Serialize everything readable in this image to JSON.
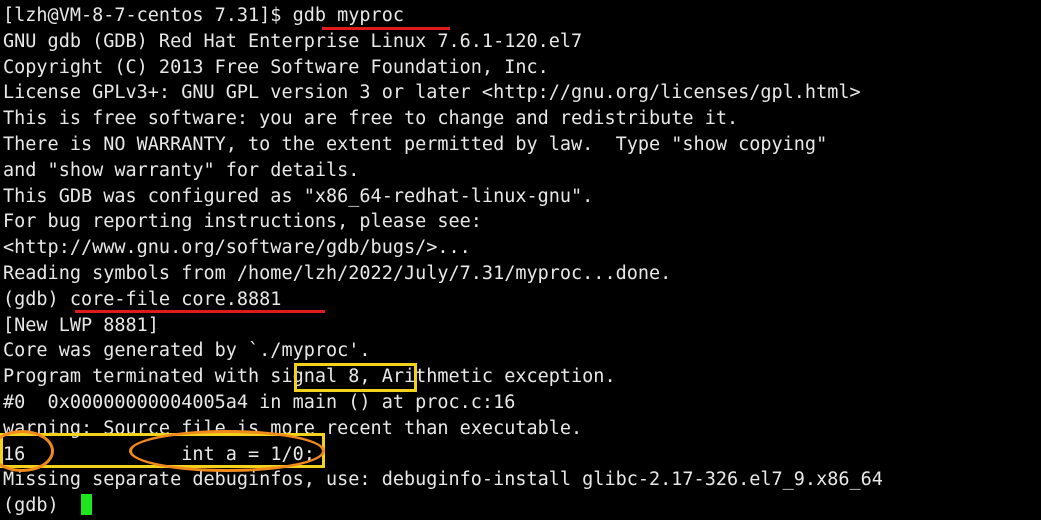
{
  "terminal": {
    "lines": [
      "[lzh@VM-8-7-centos 7.31]$ gdb myproc",
      "GNU gdb (GDB) Red Hat Enterprise Linux 7.6.1-120.el7",
      "Copyright (C) 2013 Free Software Foundation, Inc.",
      "License GPLv3+: GNU GPL version 3 or later <http://gnu.org/licenses/gpl.html>",
      "This is free software: you are free to change and redistribute it.",
      "There is NO WARRANTY, to the extent permitted by law.  Type \"show copying\"",
      "and \"show warranty\" for details.",
      "This GDB was configured as \"x86_64-redhat-linux-gnu\".",
      "For bug reporting instructions, please see:",
      "<http://www.gnu.org/software/gdb/bugs/>...",
      "Reading symbols from /home/lzh/2022/July/7.31/myproc...done.",
      "(gdb) core-file core.8881",
      "[New LWP 8881]",
      "Core was generated by `./myproc'.",
      "Program terminated with signal 8, Arithmetic exception.",
      "#0  0x00000000004005a4 in main () at proc.c:16",
      "warning: Source file is more recent than executable.",
      "16\t        int a = 1/0;",
      "Missing separate debuginfos, use: debuginfo-install glibc-2.17-326.el7_9.x86_64",
      "(gdb) "
    ]
  },
  "colors": {
    "background": "#000000",
    "text": "#e8e8e8",
    "cursor": "#1ee61e",
    "underline_annotation": "#e01b1b",
    "box_annotation": "#f2d21a",
    "ellipse_annotation": "#f08a1c"
  }
}
